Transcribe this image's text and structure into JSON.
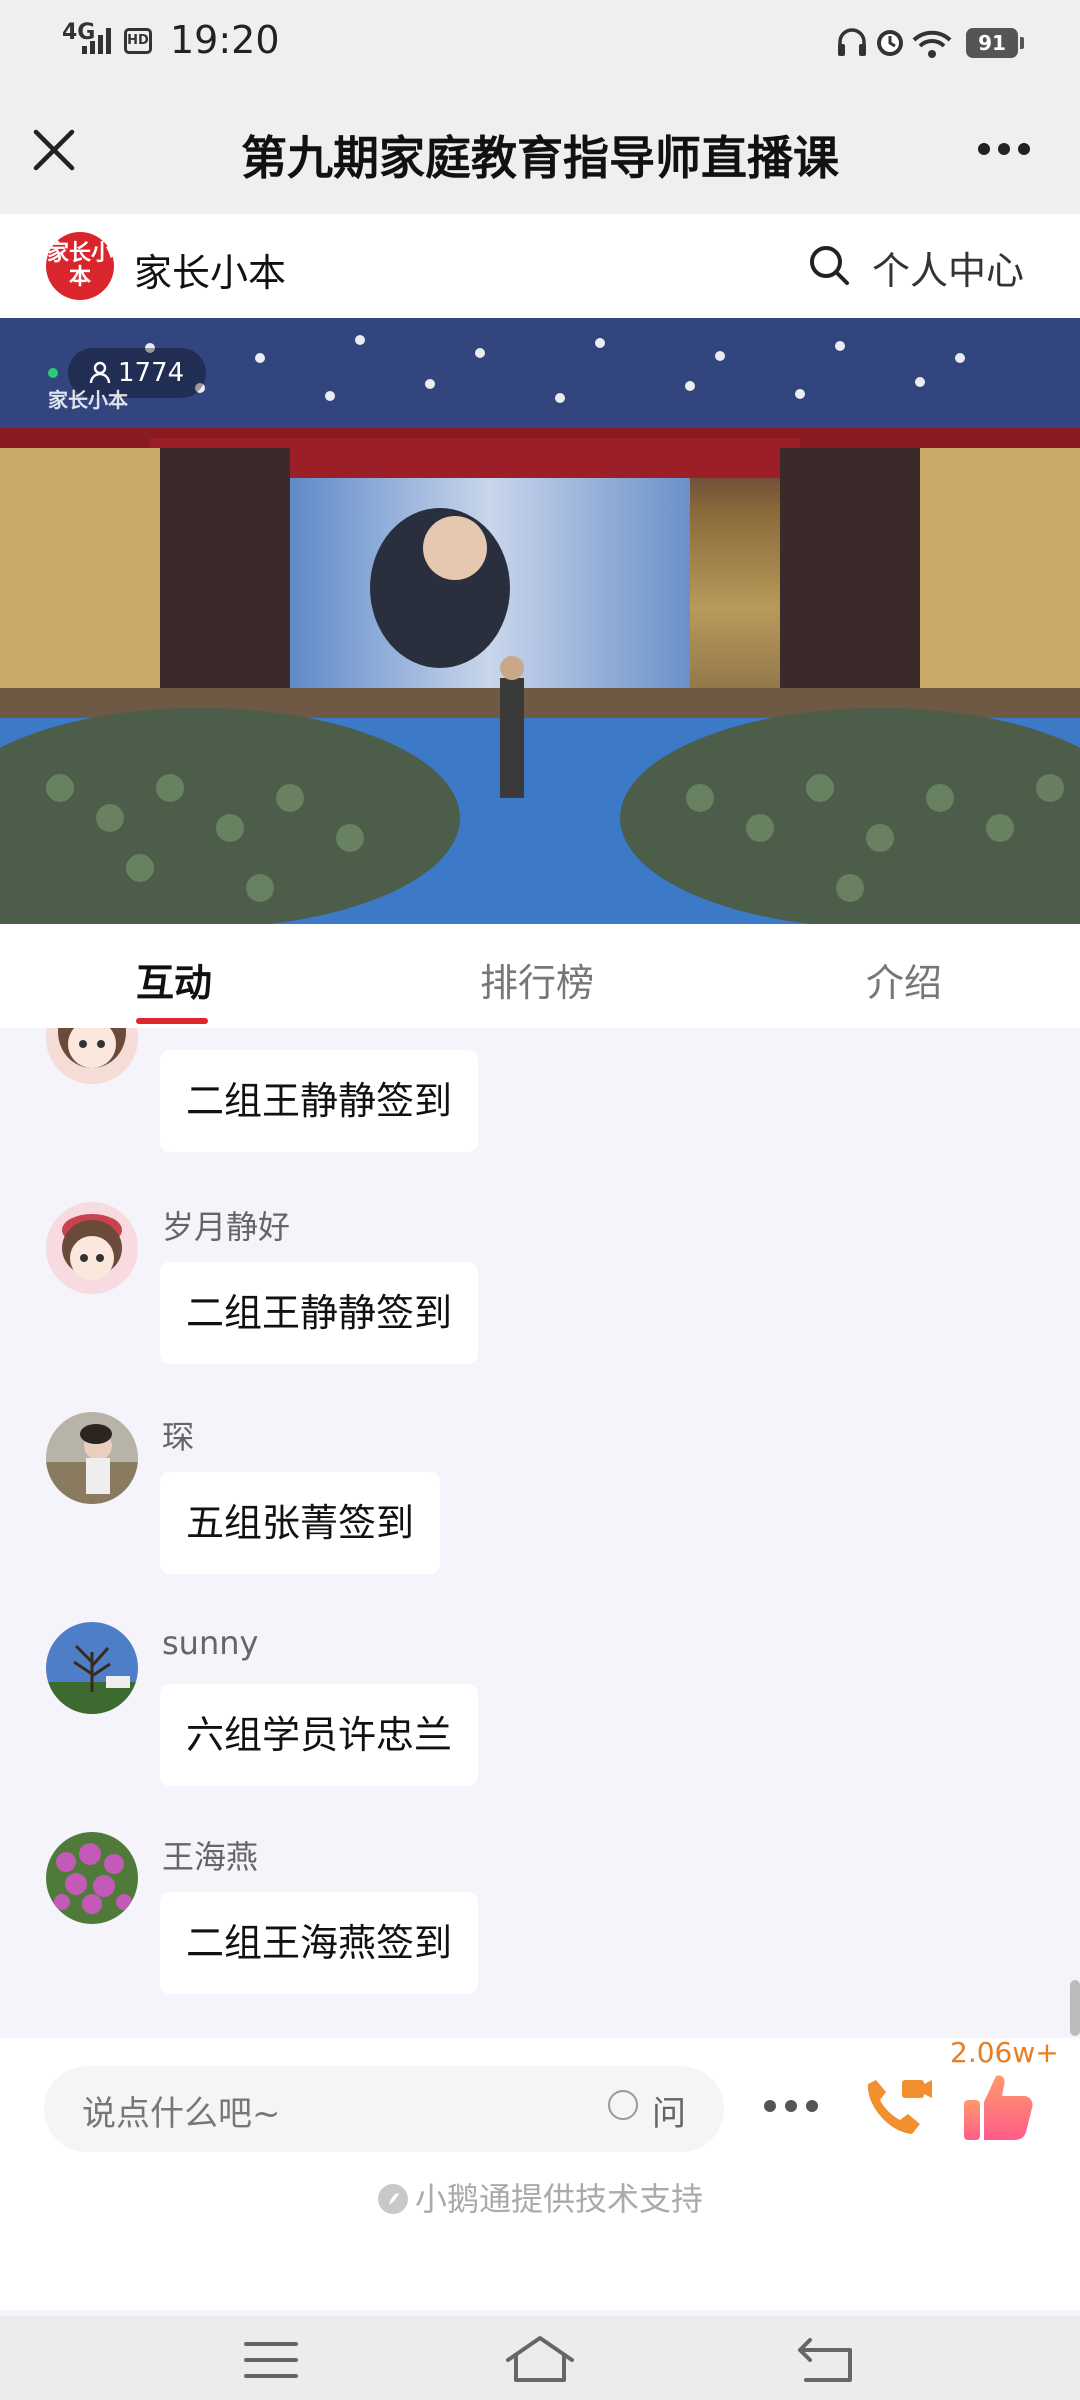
{
  "status_bar": {
    "network": "4G",
    "hd": "HD",
    "time": "19:20",
    "battery": "91"
  },
  "title_bar": {
    "title": "第九期家庭教育指导师直播课"
  },
  "channel": {
    "logo_text": "家长小本",
    "name": "家长小本",
    "personal_center": "个人中心"
  },
  "video": {
    "viewer_count": "1774",
    "watermark": "家长小本"
  },
  "tabs": [
    {
      "label": "互动",
      "active": true
    },
    {
      "label": "排行榜",
      "active": false
    },
    {
      "label": "介绍",
      "active": false
    }
  ],
  "messages": [
    {
      "user": "",
      "text": "二组王静静签到",
      "avatar": "cartoon-girl-avatar"
    },
    {
      "user": "岁月静好",
      "text": "二组王静静签到",
      "avatar": "cartoon-girl-avatar"
    },
    {
      "user": "琛",
      "text": "五组张菁签到",
      "avatar": "photo-avatar"
    },
    {
      "user": "sunny",
      "text": "六组学员许忠兰",
      "avatar": "tree-avatar"
    },
    {
      "user": "王海燕",
      "text": "二组王海燕签到",
      "avatar": "flower-avatar"
    }
  ],
  "input": {
    "placeholder": "说点什么吧~",
    "ask_label": "问"
  },
  "like_count": "2.06w+",
  "footer": "小鹅通提供技术支持",
  "colors": {
    "accent_red": "#e0262d",
    "like_orange": "#e77e23"
  }
}
